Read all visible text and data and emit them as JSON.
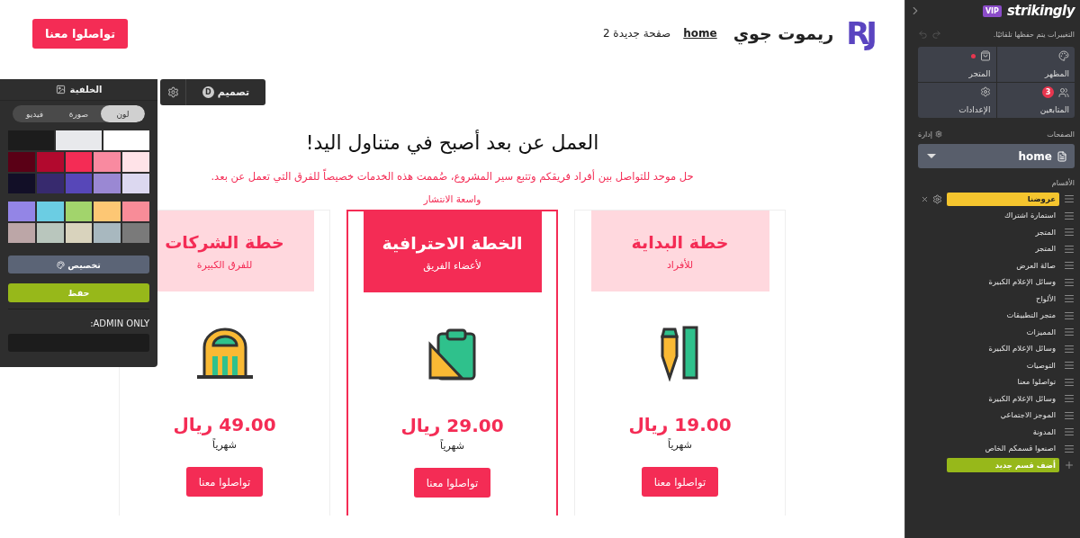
{
  "header": {
    "cta": "تواصلوا معنا",
    "logo": "RJ",
    "site_name": "ريموت جوي",
    "nav": [
      {
        "label": "home",
        "selected": true
      },
      {
        "label": "صفحة جديدة 2",
        "selected": false
      }
    ]
  },
  "design_toolbar": {
    "label": "تصميم",
    "badge": "D"
  },
  "background_panel": {
    "title": "الخلفية",
    "tabs": [
      {
        "label": "لون",
        "selected": true
      },
      {
        "label": "صورة",
        "selected": false
      },
      {
        "label": "فيديو",
        "selected": false
      }
    ],
    "swatch_groups": [
      [
        [
          {
            "color": "#1c1c1c"
          },
          {
            "color": "#e8e9ec"
          },
          {
            "color": "#ffffff"
          }
        ],
        [
          {
            "color": "#5a0016"
          },
          {
            "color": "#b2092e"
          },
          {
            "color": "#f42c55"
          },
          {
            "color": "#f98aa0"
          },
          {
            "color": "#ffe3e8"
          }
        ],
        [
          {
            "color": "#120f27"
          },
          {
            "color": "#372a6e"
          },
          {
            "color": "#5747b8"
          },
          {
            "color": "#9a88d3"
          },
          {
            "color": "#dcd8f0"
          }
        ]
      ],
      [
        [
          {
            "color": "#9385e6"
          },
          {
            "color": "#6bcde3"
          },
          {
            "color": "#a2d46c"
          },
          {
            "color": "#fdc774"
          },
          {
            "color": "#f88c98"
          }
        ],
        [
          {
            "color": "#bca6a7"
          },
          {
            "color": "#b9c6bd"
          },
          {
            "color": "#d9d3bd"
          },
          {
            "color": "#a8b8bf"
          },
          {
            "color": "#7a7a7a"
          }
        ]
      ]
    ],
    "customize": "تخصيص",
    "save": "حفظ",
    "admin_label": ":ADMIN ONLY"
  },
  "hero": {
    "title": "العمل عن بعد أصبح في متناول اليد!",
    "subtitle": "حل موحد للتواصل بين أفراد فريقكم وتتبع سير المشروع، صُممت هذه الخدمات خصيصاً للفرق التي تعمل عن بعد."
  },
  "plans": [
    {
      "name": "خطة البداية",
      "audience": "للأفراد",
      "price": "19.00 ريال",
      "period": "شهرياً",
      "button": "تواصلوا معنا",
      "featured": false
    },
    {
      "name": "الخطة الاحترافية",
      "audience": "لأعضاء الفريق",
      "price": "29.00 ريال",
      "period": "شهرياً",
      "button": "تواصلوا معنا",
      "featured": true,
      "badge": "واسعة الانتشار"
    },
    {
      "name": "خطة الشركات",
      "audience": "للفرق الكبيرة",
      "price": "49.00 ريال",
      "period": "شهرياً",
      "button": "تواصلوا معنا",
      "featured": false
    }
  ],
  "sidebar": {
    "vip": "VIP",
    "brand": "strikingly",
    "autosave": "التغييرات يتم حفظها تلقائيًا.",
    "tiles": [
      {
        "label": "المظهر",
        "dot": false
      },
      {
        "label": "المتجر",
        "dot": true
      },
      {
        "label": "المتابعين",
        "dot": false,
        "count": "3"
      },
      {
        "label": "الإعدادات",
        "dot": false
      }
    ],
    "pages_label": "الصفحات",
    "manage": "إدارة",
    "current_page": "home",
    "sections_label": "الأقسام",
    "sections": [
      {
        "label": "عروضنا",
        "selected": true
      },
      {
        "label": "استمارة اشتراك",
        "selected": false
      },
      {
        "label": "المتجر",
        "selected": false
      },
      {
        "label": "المتجر",
        "selected": false
      },
      {
        "label": "صالة العرض",
        "selected": false
      },
      {
        "label": "وسائل الإعلام الكبيرة",
        "selected": false
      },
      {
        "label": "الألواح",
        "selected": false
      },
      {
        "label": "متجر التطبيقات",
        "selected": false
      },
      {
        "label": "المميزات",
        "selected": false
      },
      {
        "label": "وسائل الإعلام الكبيرة",
        "selected": false
      },
      {
        "label": "التوصيات",
        "selected": false
      },
      {
        "label": "تواصلوا معنا",
        "selected": false
      },
      {
        "label": "وسائل الإعلام الكبيرة",
        "selected": false
      },
      {
        "label": "الموجز الاجتماعي",
        "selected": false
      },
      {
        "label": "المدونة",
        "selected": false
      },
      {
        "label": "اصنعوا قسمكم الخاص",
        "selected": false
      }
    ],
    "add_section": "أضف قسم جديد"
  }
}
